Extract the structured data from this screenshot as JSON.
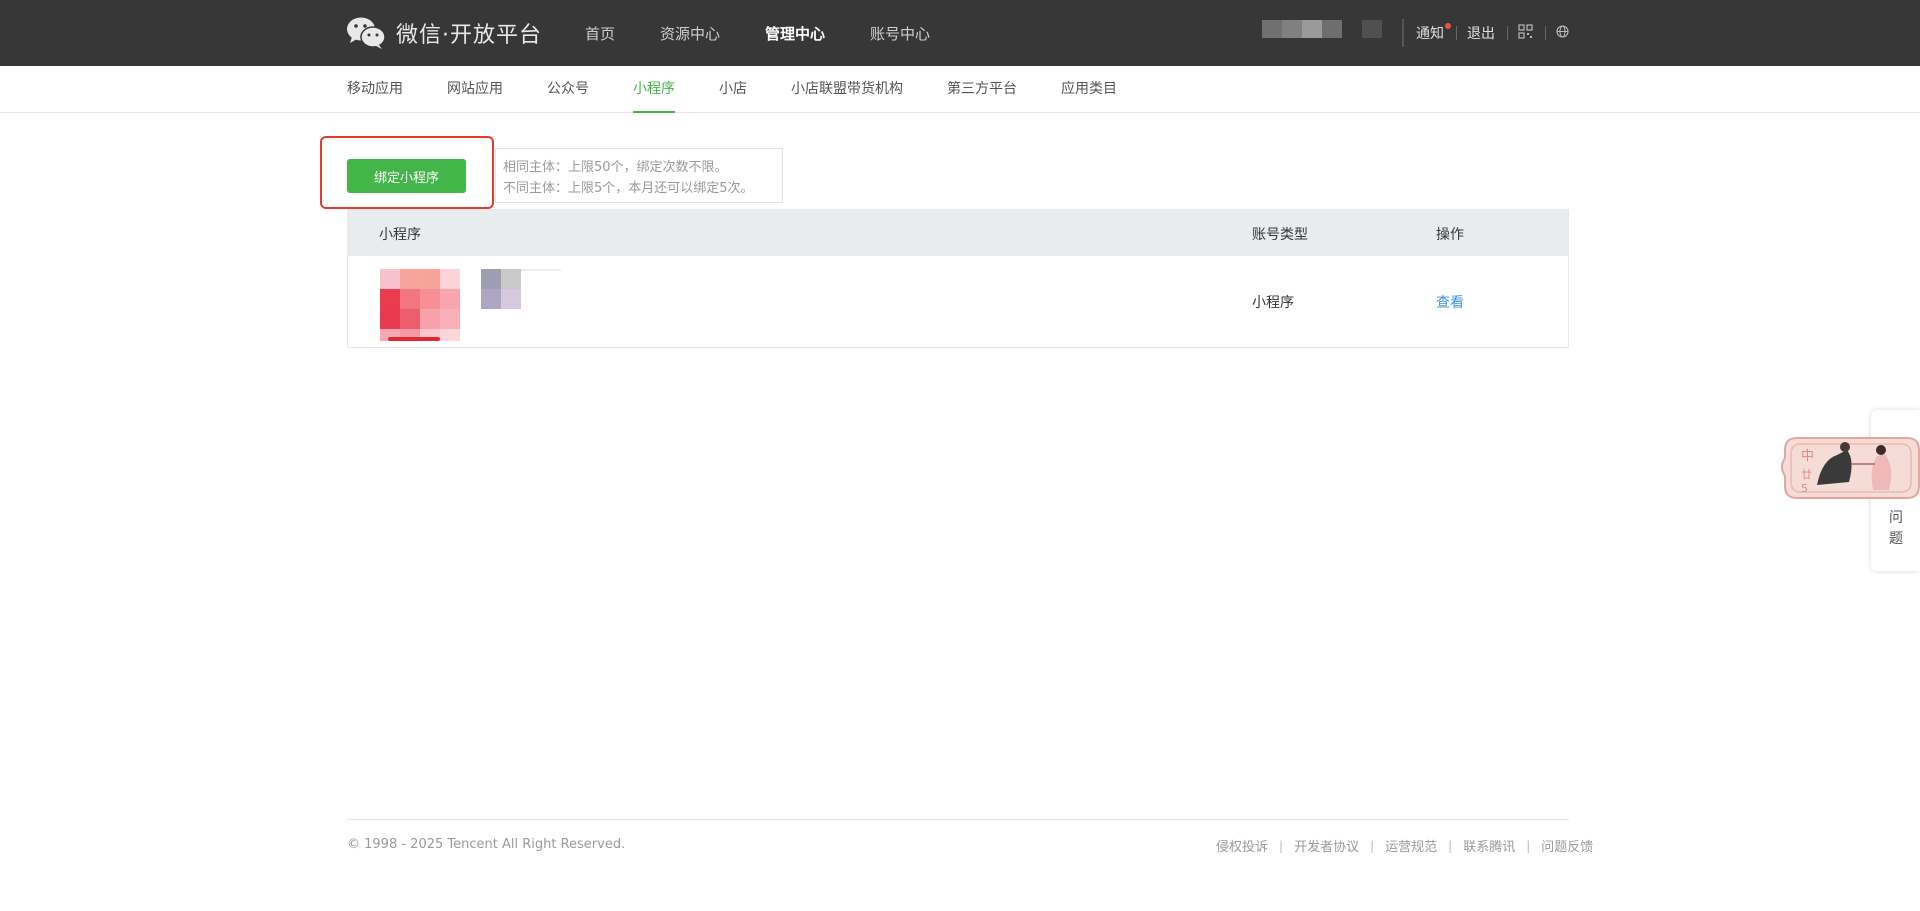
{
  "header": {
    "brand": "微信·开放平台",
    "nav": [
      "首页",
      "资源中心",
      "管理中心",
      "账号中心"
    ],
    "active_nav": "管理中心",
    "notice": "通知",
    "logout": "退出"
  },
  "subnav": {
    "items": [
      "移动应用",
      "网站应用",
      "公众号",
      "小程序",
      "小店",
      "小店联盟带货机构",
      "第三方平台",
      "应用类目"
    ],
    "active": "小程序"
  },
  "bind": {
    "button_label": "绑定小程序",
    "tips": [
      "相同主体：上限50个，绑定次数不限。",
      "不同主体：上限5个，本月还可以绑定5次。"
    ]
  },
  "table": {
    "columns": [
      "小程序",
      "账号类型",
      "操作"
    ],
    "rows": [
      {
        "type": "小程序",
        "action": "查看"
      }
    ]
  },
  "footer": {
    "copyright": "© 1998 - 2025 Tencent All Right Reserved.",
    "links": [
      "侵权投诉",
      "开发者协议",
      "运营规范",
      "联系腾讯",
      "问题反馈"
    ]
  },
  "float_widget": {
    "text": "问题"
  },
  "colors": {
    "header_bg": "#373737",
    "accent_green": "#44b549",
    "link_blue": "#3e90e8",
    "highlight_red": "#e53b2c"
  }
}
